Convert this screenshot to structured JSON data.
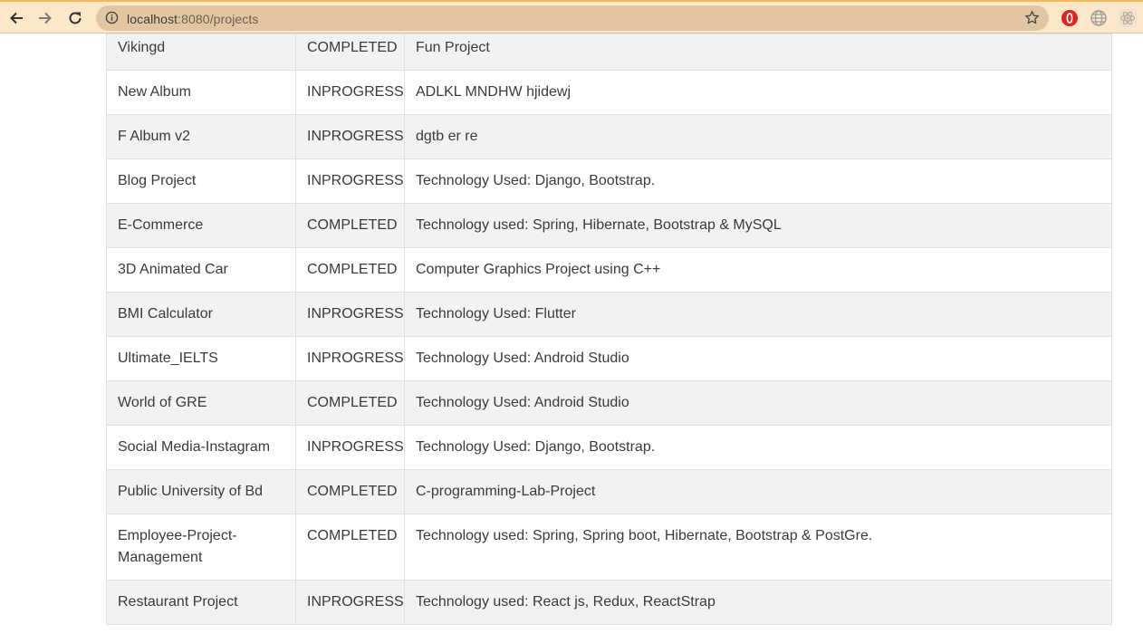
{
  "browser": {
    "url_host": "localhost",
    "url_port_path": ":8080/projects",
    "icons": {
      "back": "arrow-left-icon",
      "forward": "arrow-right-icon",
      "reload": "reload-icon",
      "info": "info-icon",
      "star": "star-icon"
    }
  },
  "projects": [
    {
      "name": "Vikingd",
      "status": "COMPLETED",
      "description": "Fun Project"
    },
    {
      "name": "New Album",
      "status": "INPROGRESS",
      "description": "ADLKL MNDHW hjidewj"
    },
    {
      "name": "F Album v2",
      "status": "INPROGRESS",
      "description": "dgtb er re"
    },
    {
      "name": "Blog Project",
      "status": "INPROGRESS",
      "description": "Technology Used: Django, Bootstrap."
    },
    {
      "name": "E-Commerce",
      "status": "COMPLETED",
      "description": "Technology used: Spring, Hibernate, Bootstrap & MySQL"
    },
    {
      "name": "3D Animated Car",
      "status": "COMPLETED",
      "description": "Computer Graphics Project using C++"
    },
    {
      "name": "BMI Calculator",
      "status": "INPROGRESS",
      "description": "Technology Used: Flutter"
    },
    {
      "name": "Ultimate_IELTS",
      "status": "INPROGRESS",
      "description": "Technology Used: Android Studio"
    },
    {
      "name": "World of GRE",
      "status": "COMPLETED",
      "description": "Technology Used: Android Studio"
    },
    {
      "name": "Social Media-Instagram",
      "status": "INPROGRESS",
      "description": "Technology Used: Django, Bootstrap."
    },
    {
      "name": "Public University of Bd",
      "status": "COMPLETED",
      "description": "C-programming-Lab-Project"
    },
    {
      "name": "Employee-Project-Management",
      "status": "COMPLETED",
      "description": "Technology used: Spring, Spring boot, Hibernate, Bootstrap & PostGre."
    },
    {
      "name": "Restaurant Project",
      "status": "INPROGRESS",
      "description": "Technology used: React js, Redux, ReactStrap"
    }
  ]
}
